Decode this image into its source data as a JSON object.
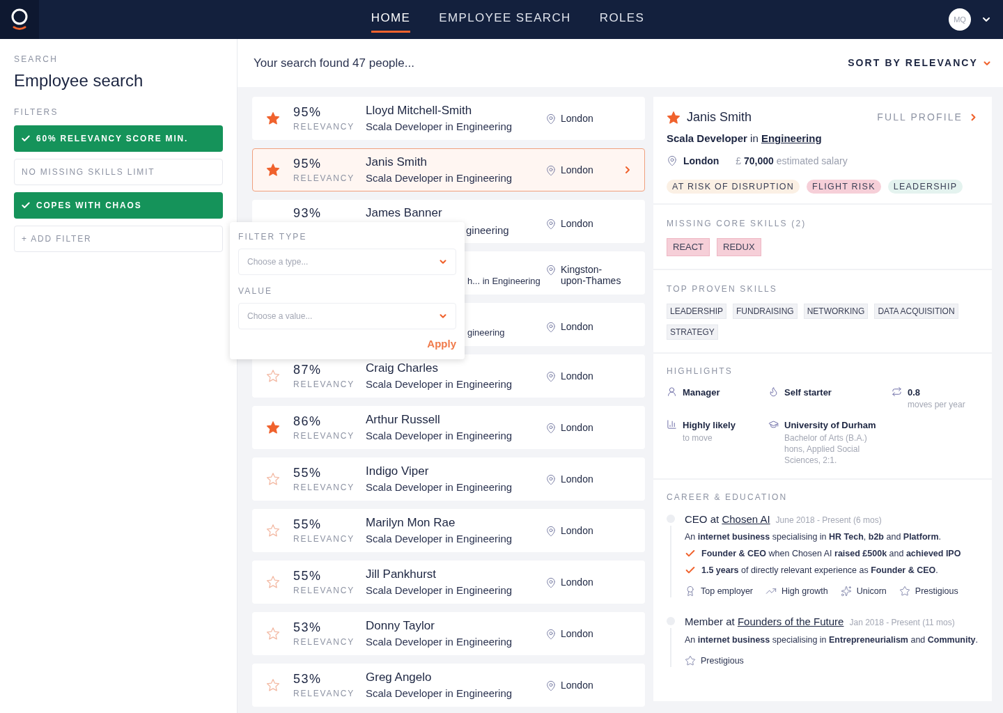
{
  "nav": {
    "items": [
      {
        "label": "HOME",
        "selected": true
      },
      {
        "label": "EMPLOYEE SEARCH",
        "selected": false
      },
      {
        "label": "ROLES",
        "selected": false
      }
    ],
    "avatar": "MQ"
  },
  "sidebar": {
    "eyebrow": "SEARCH",
    "title": "Employee search",
    "filters_label": "FILTERS",
    "filters": [
      {
        "label": "60% RELEVANCY SCORE MIN.",
        "kind": "active"
      },
      {
        "label": "NO MISSING SKILLS LIMIT",
        "kind": "inactive"
      },
      {
        "label": "COPES WITH CHAOS",
        "kind": "active"
      }
    ],
    "add_filter": "+ ADD FILTER"
  },
  "results": {
    "summary": "Your search found 47 people...",
    "sort": "SORT BY RELEVANCY",
    "rows": [
      {
        "kind": "full",
        "starred": true,
        "selected": false,
        "percent": "95%",
        "relevancy": "RELEVANCY",
        "name": "Lloyd Mitchell-Smith",
        "role": "Scala Developer in Engineering",
        "location": "London"
      },
      {
        "kind": "full",
        "starred": true,
        "selected": true,
        "percent": "95%",
        "relevancy": "RELEVANCY",
        "name": "Janis Smith",
        "role": "Scala Developer in Engineering",
        "location": "London"
      },
      {
        "kind": "covered",
        "selected": false,
        "percent": "93%",
        "name": "James Banner",
        "role": "gineering",
        "location": "London"
      },
      {
        "kind": "covered",
        "selected": false,
        "role": "h... in Engineering",
        "location": "Kingston-upon-Thames"
      },
      {
        "kind": "covered",
        "selected": false,
        "role": "gineering",
        "location": "London"
      },
      {
        "kind": "full",
        "starred": false,
        "selected": false,
        "percent": "87%",
        "relevancy": "RELEVANCY",
        "name": "Craig Charles",
        "role": "Scala Developer in Engineering",
        "location": "London"
      },
      {
        "kind": "full",
        "starred": true,
        "selected": false,
        "percent": "86%",
        "relevancy": "RELEVANCY",
        "name": "Arthur Russell",
        "role": "Scala Developer in Engineering",
        "location": "London"
      },
      {
        "kind": "full",
        "starred": false,
        "selected": false,
        "percent": "55%",
        "relevancy": "RELEVANCY",
        "name": "Indigo Viper",
        "role": "Scala Developer in Engineering",
        "location": "London"
      },
      {
        "kind": "full",
        "starred": false,
        "selected": false,
        "percent": "55%",
        "relevancy": "RELEVANCY",
        "name": "Marilyn Mon Rae",
        "role": "Scala Developer in Engineering",
        "location": "London"
      },
      {
        "kind": "full",
        "starred": false,
        "selected": false,
        "percent": "55%",
        "relevancy": "RELEVANCY",
        "name": "Jill Pankhurst",
        "role": "Scala Developer in Engineering",
        "location": "London"
      },
      {
        "kind": "full",
        "starred": false,
        "selected": false,
        "percent": "53%",
        "relevancy": "RELEVANCY",
        "name": "Donny Taylor",
        "role": "Scala Developer in Engineering",
        "location": "London"
      },
      {
        "kind": "full",
        "starred": false,
        "selected": false,
        "percent": "53%",
        "relevancy": "RELEVANCY",
        "name": "Greg Angelo",
        "role": "Scala Developer in Engineering",
        "location": "London"
      }
    ]
  },
  "filter_popup": {
    "type_label": "FILTER TYPE",
    "type_placeholder": "Choose a type...",
    "value_label": "VALUE",
    "value_placeholder": "Choose a value...",
    "apply": "Apply"
  },
  "profile": {
    "starred": true,
    "name": "Janis Smith",
    "full_profile": "FULL PROFILE",
    "role": "Scala Developer",
    "connector": "in",
    "department": "Engineering",
    "location": "London",
    "salary": "£ **70,000** estimated salary",
    "tags": [
      {
        "label": "AT RISK OF DISRUPTION",
        "color": "#fbf0e4"
      },
      {
        "label": "FLIGHT RISK",
        "color": "#f6cfd8"
      },
      {
        "label": "LEADERSHIP",
        "color": "#e4f3ef"
      }
    ],
    "missing_label": "MISSING CORE SKILLS (2)",
    "missing": [
      "REACT",
      "REDUX"
    ],
    "top_label": "TOP PROVEN SKILLS",
    "top": [
      "LEADERSHIP",
      "FUNDRAISING",
      "NETWORKING",
      "DATA ACQUISITION",
      "STRATEGY"
    ],
    "highlights_label": "HIGHLIGHTS",
    "highlights": [
      {
        "kind": "manager",
        "title": "Manager"
      },
      {
        "kind": "starter",
        "title": "Self starter"
      },
      {
        "kind": "moves",
        "title": "0.8",
        "detail": "moves per year"
      },
      {
        "kind": "likely",
        "title": "Highly likely",
        "detail": "to move"
      },
      {
        "kind": "education",
        "title": "University of Durham",
        "detail": "Bachelor of Arts (B.A.) hons, Applied Social Sciences, 2:1."
      }
    ],
    "career_label": "CAREER & EDUCATION",
    "career": [
      {
        "role": "CEO",
        "connector": "at",
        "company": "Chosen AI",
        "dates": "June 2018 - Present (6 mos)",
        "description": "An **internet business** specialising in **HR Tech**, **b2b** and **Platform**.",
        "achievements": [
          "**Founder & CEO** when Chosen AI **raised £500k** and **achieved IPO**",
          "**1.5 years** of directly relevant experience as **Founder & CEO**."
        ],
        "badges": [
          {
            "kind": "top",
            "label": "Top employer"
          },
          {
            "kind": "growth",
            "label": "High growth"
          },
          {
            "kind": "unicorn",
            "label": "Unicorn"
          },
          {
            "kind": "prestige",
            "label": "Prestigious"
          }
        ]
      },
      {
        "role": "Member",
        "connector": "at",
        "company": "Founders of the Future",
        "dates": "Jan 2018 - Present (11 mos)",
        "description": "An **internet business** specialising in **Entrepreneurialism** and **Community**.",
        "badges": [
          {
            "kind": "prestige",
            "label": "Prestigious"
          }
        ]
      }
    ]
  }
}
